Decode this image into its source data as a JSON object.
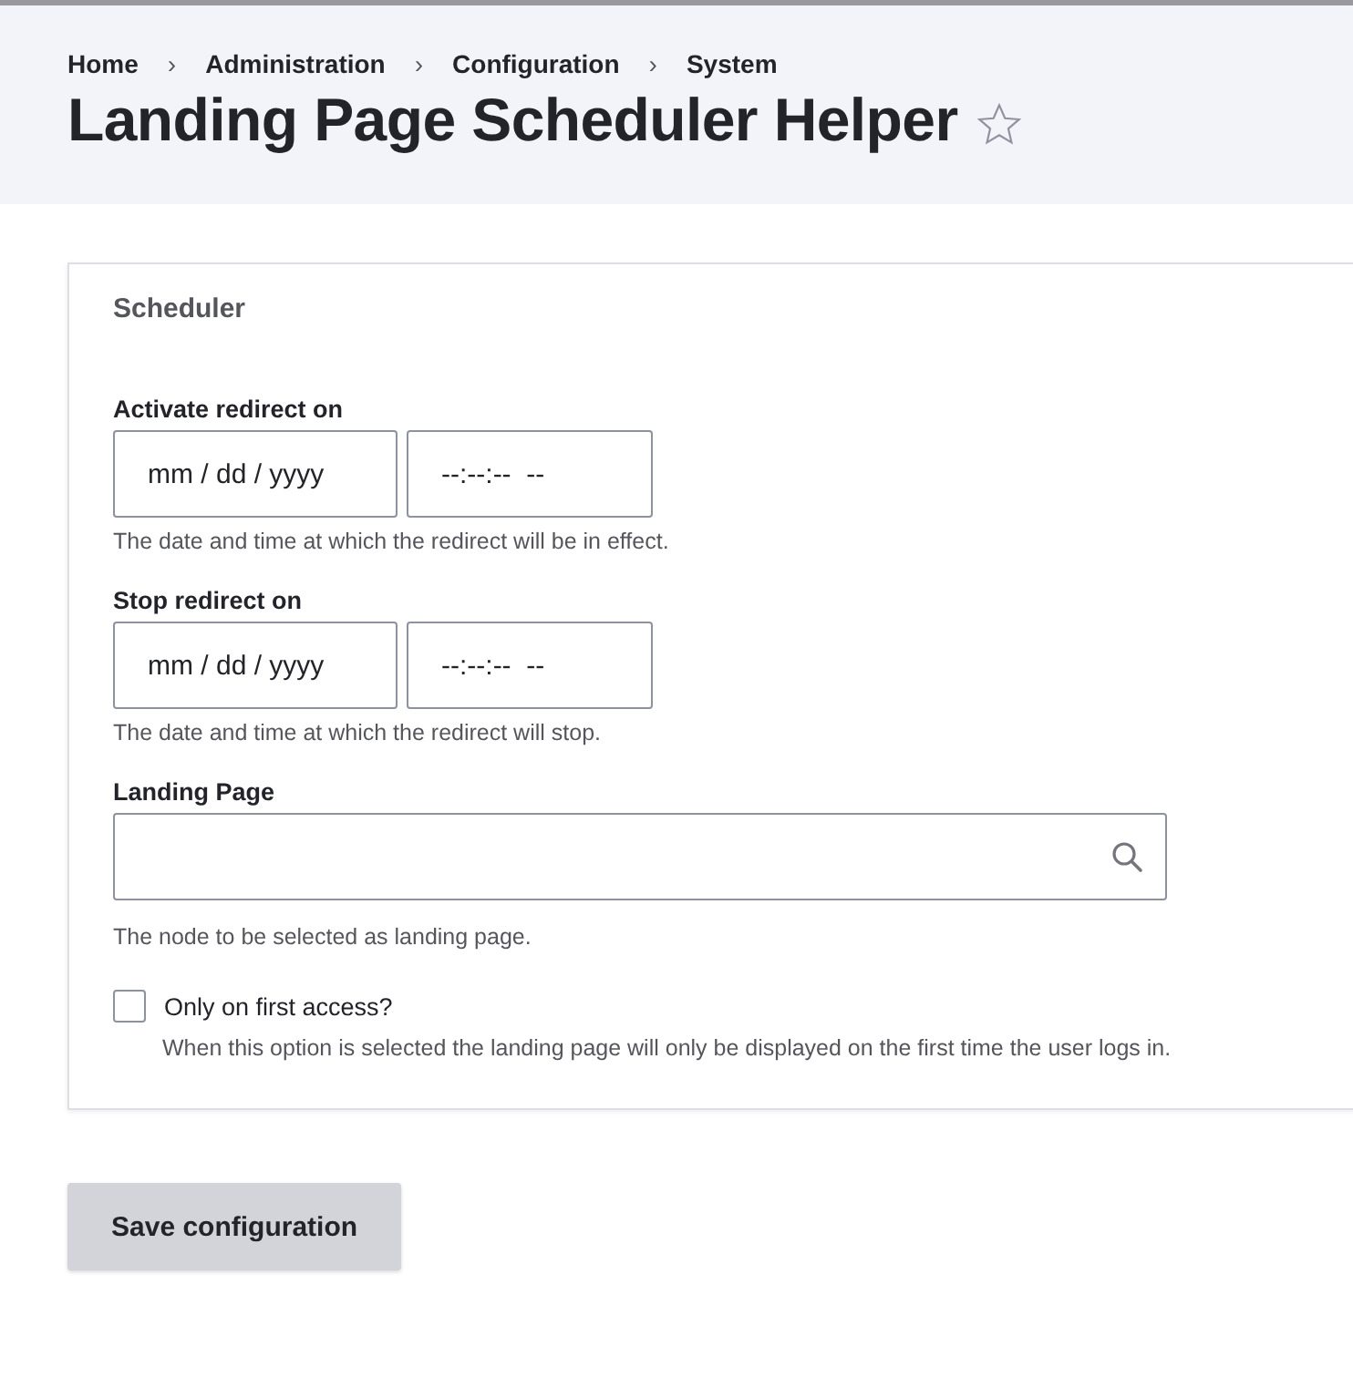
{
  "breadcrumb": [
    {
      "label": "Home"
    },
    {
      "label": "Administration"
    },
    {
      "label": "Configuration"
    },
    {
      "label": "System"
    }
  ],
  "breadcrumb_separator": "›",
  "title": "Landing Page Scheduler Helper",
  "favorite": {
    "selected": false
  },
  "fieldset": {
    "legend": "Scheduler",
    "fields": [
      {
        "kind": "datetime",
        "label": "Activate redirect on",
        "date_placeholder": "mm / dd / yyyy",
        "time_placeholder": "--:--:--  --",
        "description": "The date and time at which the redirect will be in effect."
      },
      {
        "kind": "datetime",
        "label": "Stop redirect on",
        "date_placeholder": "mm / dd / yyyy",
        "time_placeholder": "--:--:--  --",
        "description": "The date and time at which the redirect will stop."
      },
      {
        "kind": "autocomplete",
        "label": "Landing Page",
        "description": "The node to be selected as landing page."
      },
      {
        "kind": "checkbox",
        "label": "Only on first access?",
        "checked": false,
        "description": "When this option is selected the landing page will only be displayed on the first time the user logs in."
      }
    ]
  },
  "buttons": [
    {
      "label": "Save configuration"
    }
  ]
}
